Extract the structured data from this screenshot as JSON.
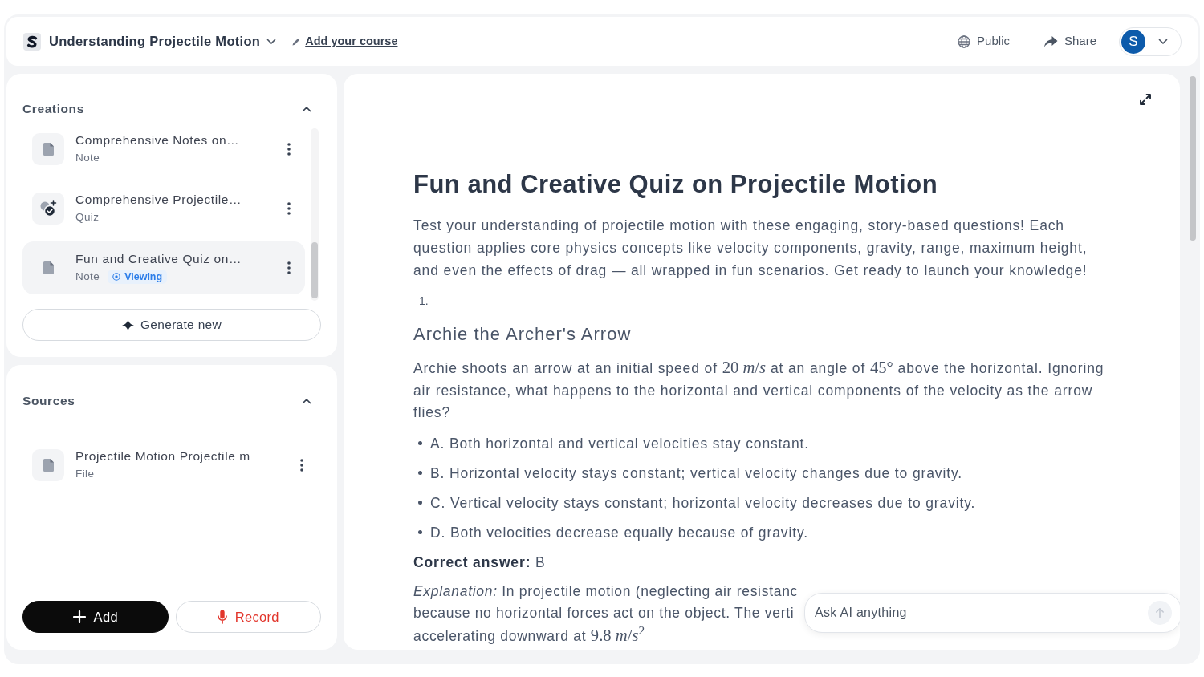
{
  "header": {
    "course_title": "Understanding Projectile Motion",
    "add_course_link": "Add your course",
    "actions": [
      {
        "kind": "visibility",
        "label": "Public"
      },
      {
        "kind": "share",
        "label": "Share"
      }
    ],
    "account": {
      "initial": "S"
    }
  },
  "creations": {
    "title": "Creations",
    "expanded": true,
    "items": [
      {
        "kind": "note",
        "title": "Comprehensive Notes on…",
        "type": "Note",
        "selected": false
      },
      {
        "kind": "quiz",
        "title": "Comprehensive Projectile…",
        "type": "Quiz",
        "selected": false
      },
      {
        "kind": "note",
        "title": "Fun and Creative Quiz on…",
        "type": "Note",
        "selected": true,
        "badge": "Viewing"
      }
    ],
    "generate_button": "Generate new"
  },
  "sources": {
    "title": "Sources",
    "expanded": true,
    "items": [
      {
        "kind": "file",
        "title": "Projectile Motion Projectile m",
        "type": "File",
        "selected": false
      }
    ]
  },
  "source_buttons": [
    {
      "kind": "add",
      "label": "Add"
    },
    {
      "kind": "record",
      "label": "Record"
    }
  ],
  "document": {
    "title": "Fun and Creative Quiz on Projectile Motion",
    "intro": "Test your understanding of projectile motion with these engaging, story-based questions! Each question applies core physics concepts like velocity components, gravity, range, maximum height, and even the effects of drag — all wrapped in fun scenarios. Get ready to launch your knowledge!",
    "questions": [
      {
        "number": "1.",
        "heading": "Archie the Archer's Arrow",
        "prompt": [
          {
            "kind": "text",
            "text": "Archie shoots an arrow at an initial speed of "
          },
          {
            "kind": "math",
            "text": "20 *m*/*s*"
          },
          {
            "kind": "text",
            "text": " at an angle of "
          },
          {
            "kind": "math",
            "text": "45°"
          },
          {
            "kind": "text",
            "text": " above the horizontal. Ignoring air resistance, what happens to the horizontal and vertical components of the velocity as the arrow flies?"
          }
        ],
        "options": [
          "A. Both horizontal and vertical velocities stay constant.",
          "B. Horizontal velocity stays constant; vertical velocity changes due to gravity.",
          "C. Vertical velocity stays constant; horizontal velocity decreases due to gravity.",
          "D. Both velocities decrease equally because of gravity."
        ],
        "answer": "**Correct answer:** B",
        "explanation_lines": [
          [
            {
              "kind": "text",
              "text": "*Explanation:* In projectile motion (neglecting air resistanc"
            }
          ],
          [
            {
              "kind": "text",
              "text": "because no horizontal forces act on the object. The verti"
            }
          ],
          [
            {
              "kind": "text",
              "text": "accelerating downward at "
            },
            {
              "kind": "math",
              "text": "9.8 *m*/*s*$^{2}$"
            }
          ]
        ]
      }
    ]
  },
  "ask_ai": {
    "placeholder": "Ask AI anything",
    "send_disabled": true
  }
}
